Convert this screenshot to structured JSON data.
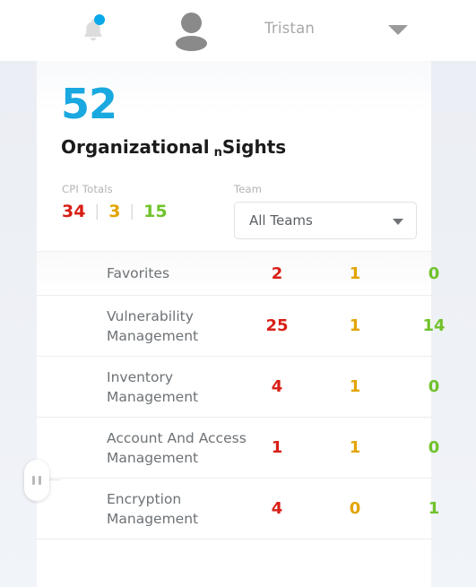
{
  "header": {
    "notification_icon": "bell-icon",
    "has_notification": true,
    "avatar_icon": "user-avatar-icon",
    "user_name": "Tristan",
    "caret_icon": "chevron-down-icon"
  },
  "summary": {
    "count": "52",
    "title_main": "Organizational",
    "title_sub": "n",
    "title_tail": "Sights",
    "accent_color": "#19a8e0"
  },
  "cpi": {
    "label": "CPI Totals",
    "separator": "|",
    "red": "34",
    "amber": "3",
    "green": "15",
    "red_color": "#d81f16",
    "amber_color": "#e2a400",
    "green_color": "#71c22b"
  },
  "team": {
    "label": "Team",
    "selected": "All Teams",
    "caret_icon": "chevron-down-icon"
  },
  "table": {
    "rows": [
      {
        "name": "Favorites",
        "red": "2",
        "amber": "1",
        "green": "0"
      },
      {
        "name": "Vulnerability Management",
        "red": "25",
        "amber": "1",
        "green": "14"
      },
      {
        "name": "Inventory Management",
        "red": "4",
        "amber": "1",
        "green": "0"
      },
      {
        "name": "Account And Access Management",
        "red": "1",
        "amber": "1",
        "green": "0"
      },
      {
        "name": "Encryption Management",
        "red": "4",
        "amber": "0",
        "green": "1"
      }
    ]
  },
  "drag_handle": {
    "icon": "drag-grip-icon"
  }
}
